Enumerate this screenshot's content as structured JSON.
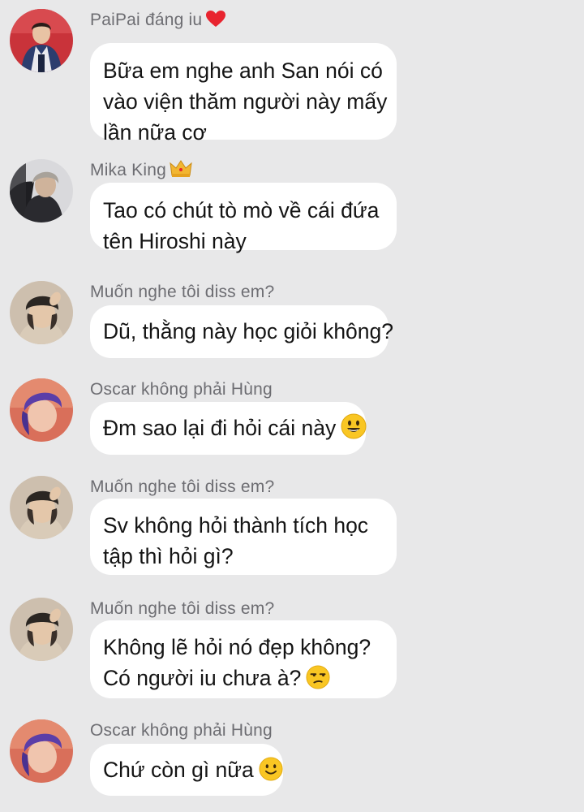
{
  "messages": [
    {
      "sender": "PaiPai đáng iu",
      "sender_badge": "heart-icon",
      "avatar": "avatar-red-jacket",
      "lines": [
        "Bữa em nghe anh San nói có",
        "vào viện thăm người này mấy",
        "lần nữa cơ"
      ]
    },
    {
      "sender": "Mika King",
      "sender_badge": "crown-icon",
      "avatar": "avatar-dark-hood",
      "lines": [
        "Tao có chút tò mò về cái đứa",
        "tên Hiroshi này"
      ]
    },
    {
      "sender": "Muốn nghe tôi diss em?",
      "avatar": "avatar-beanie",
      "lines": [
        "Dũ, thằng này học giỏi không?"
      ]
    },
    {
      "sender": "Oscar không phải Hùng",
      "avatar": "avatar-purple-hair",
      "lines": [
        "Đm sao lại đi hỏi cái này"
      ],
      "emoji": "grinning-face-icon"
    },
    {
      "sender": "Muốn nghe tôi diss em?",
      "avatar": "avatar-beanie",
      "lines": [
        "Sv không hỏi thành tích học",
        "tập thì hỏi gì?"
      ]
    },
    {
      "sender": "Muốn nghe tôi diss em?",
      "avatar": "avatar-beanie",
      "lines": [
        "Không lẽ hỏi nó đẹp không?",
        "Có người iu chưa à?"
      ],
      "emoji": "unamused-face-icon"
    },
    {
      "sender": "Oscar không phải Hùng",
      "avatar": "avatar-purple-hair",
      "lines": [
        "Chứ còn gì nữa"
      ],
      "emoji": "slightly-smiling-face-icon"
    }
  ],
  "colors": {
    "background": "#e8e8e9",
    "bubble": "#ffffff",
    "sender_text": "#6d6d72",
    "message_text": "#141414",
    "heart": "#e8242f",
    "crown": "#f2b632"
  }
}
